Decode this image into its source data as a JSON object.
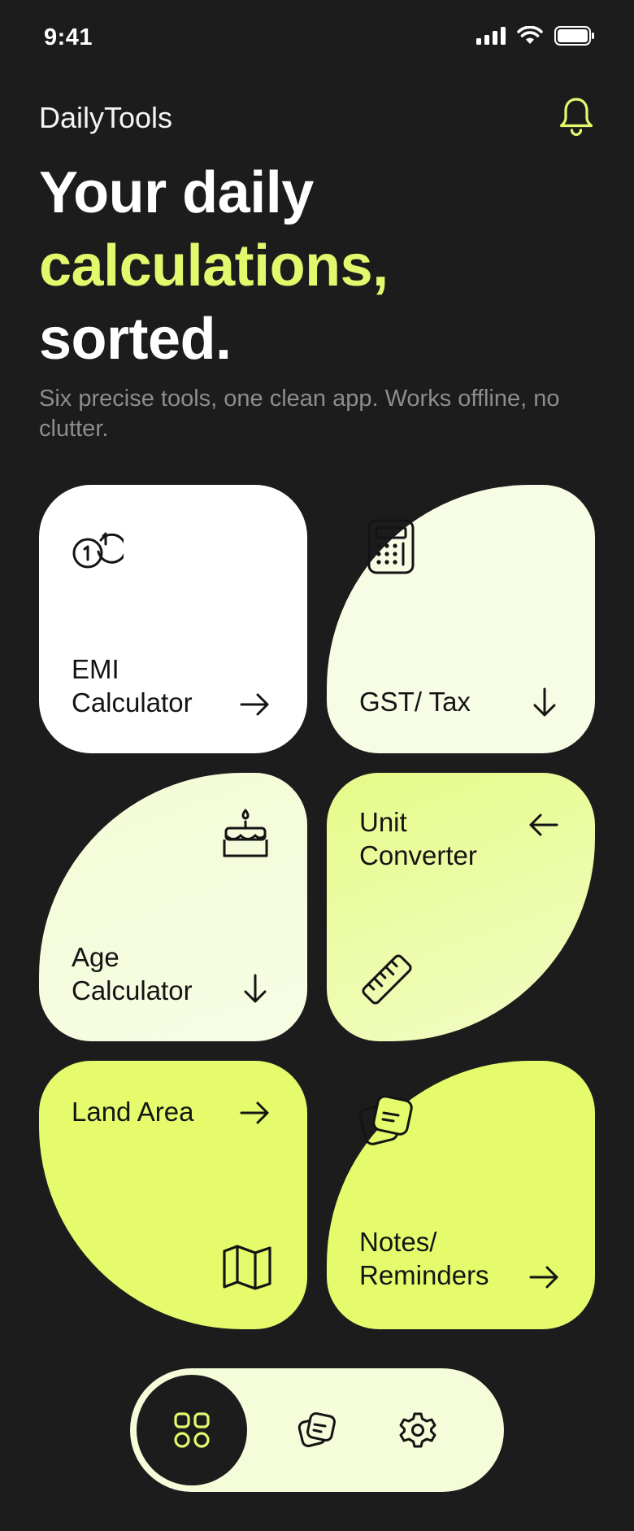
{
  "status_bar": {
    "time": "9:41",
    "icons": [
      "signal-icon",
      "wifi-icon",
      "battery-icon"
    ]
  },
  "header": {
    "app_name": "DailyTools",
    "notification_icon": "bell-icon",
    "headline": {
      "line1": "Your daily",
      "line2": "calculations,",
      "line3": "sorted."
    },
    "subtitle": "Six precise tools, one clean app. Works offline, no clutter."
  },
  "tools": [
    {
      "label_1": "EMI",
      "label_2": "Calculator",
      "icon": "coins-icon",
      "arrow": "arrow-right-icon"
    },
    {
      "label_1": "GST/ Tax",
      "label_2": "",
      "icon": "calculator-icon",
      "arrow": "arrow-down-icon"
    },
    {
      "label_1": "Age",
      "label_2": "Calculator",
      "icon": "cake-icon",
      "arrow": "arrow-down-icon"
    },
    {
      "label_1": "Unit",
      "label_2": "Converter",
      "icon": "ruler-icon",
      "arrow": "arrow-left-icon"
    },
    {
      "label_1": "Land Area",
      "label_2": "",
      "icon": "map-icon",
      "arrow": "arrow-right-icon"
    },
    {
      "label_1": "Notes/",
      "label_2": "Reminders",
      "icon": "notes-icon",
      "arrow": "arrow-right-icon"
    }
  ],
  "bottom_nav": {
    "items": [
      "grid-icon",
      "notes-icon",
      "gear-icon"
    ],
    "active_index": 0
  },
  "colors": {
    "background": "#1c1c1c",
    "accent": "#e3f86c",
    "tile_white": "#ffffff",
    "tile_pale": "#f6fde4",
    "tile_lime": "#e5fb6c",
    "subtitle_gray": "#8d8d8d"
  }
}
